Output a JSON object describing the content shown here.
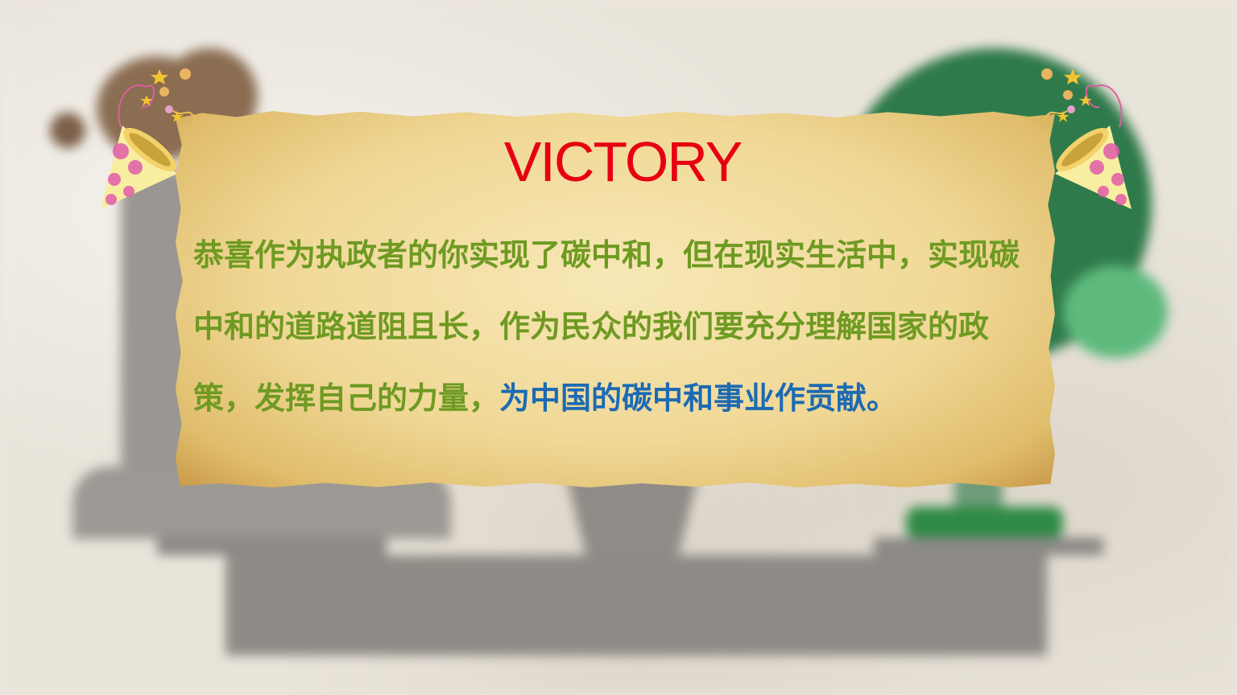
{
  "card": {
    "title": "VICTORY",
    "body_main": "恭喜作为执政者的你实现了碳中和，但在现实生活中，实现碳中和的道路道阻且长，作为民众的我们要充分理解国家的政策，发挥自己的力量，",
    "body_highlight": "为中国的碳中和事业作贡献。"
  },
  "colors": {
    "title": "#e60012",
    "body_text": "#6e9a22",
    "highlight_text": "#1c6ab3",
    "card_parchment": "#f0d896"
  },
  "decorations": {
    "left": "party-hat-icon",
    "right": "party-hat-icon"
  }
}
